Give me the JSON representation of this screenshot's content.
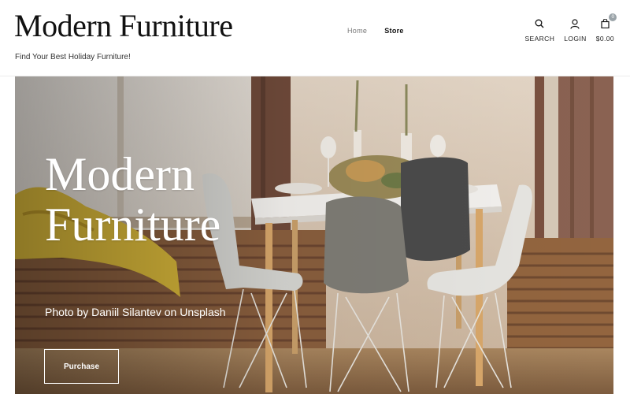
{
  "site": {
    "title": "Modern Furniture",
    "tagline": "Find Your Best Holiday Furniture!"
  },
  "nav": {
    "items": [
      {
        "label": "Home",
        "active": false
      },
      {
        "label": "Store",
        "active": true
      }
    ]
  },
  "tools": {
    "search": {
      "label": "SEARCH",
      "icon": "search-icon"
    },
    "login": {
      "label": "LOGIN",
      "icon": "user-icon"
    },
    "cart": {
      "label": "$0.00",
      "icon": "shopping-bag-icon",
      "count": "0"
    }
  },
  "hero": {
    "title": "Modern\nFurniture",
    "credit": "Photo by Daniil Silantev on Unsplash",
    "button_label": "Purchase"
  },
  "colors": {
    "accent": "#111111",
    "nav_inactive": "#777777",
    "badge": "#9aa3a8",
    "hero_text": "#ffffff"
  }
}
